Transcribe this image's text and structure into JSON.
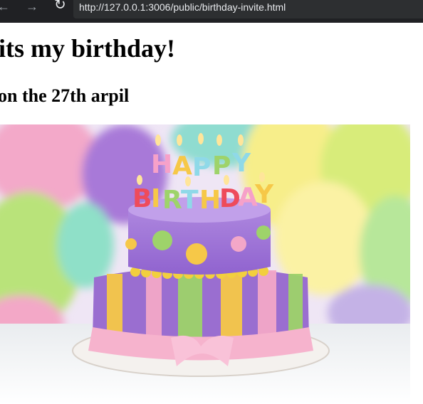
{
  "browser": {
    "url": "http://127.0.0.1:3006/public/birthday-invite.html"
  },
  "page": {
    "heading": "its my birthday!",
    "subheading": "on the 27th arpil"
  },
  "image": {
    "candle_text_line1": "HAPPY",
    "candle_text_line2": "BIRTHDAY"
  }
}
